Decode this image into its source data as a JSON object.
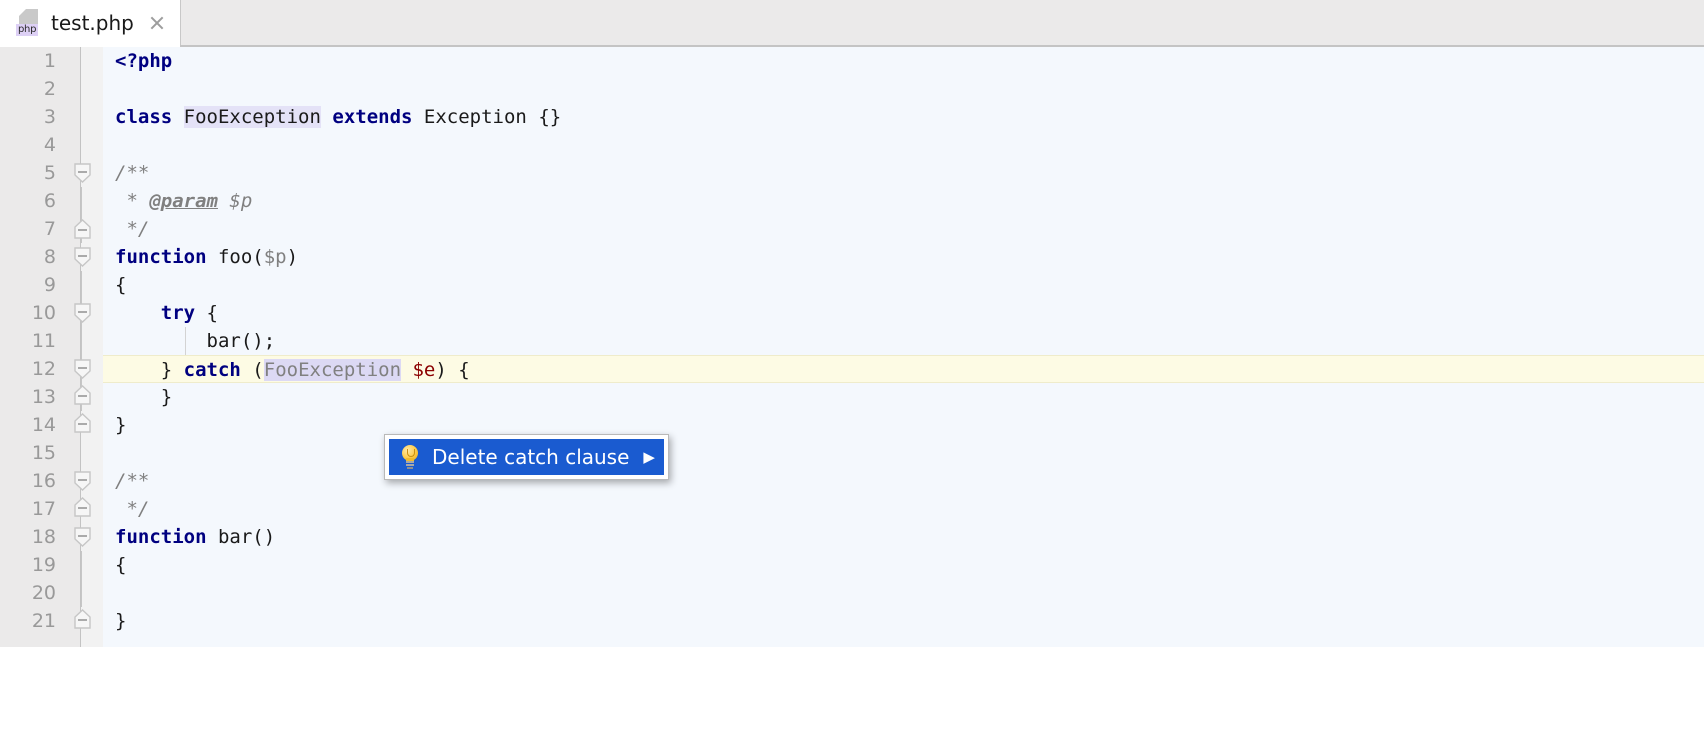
{
  "window": {
    "tabs": [
      {
        "title": "test.php",
        "icon": "php-file-icon",
        "badge": "php",
        "close_icon": "close-icon",
        "active": true
      }
    ]
  },
  "editor": {
    "language": "php",
    "current_line": 12,
    "colors": {
      "keyword": "#000080",
      "comment": "#808080",
      "variable": "#8b0000",
      "class_highlight": "#e4e2f7",
      "current_line_bg": "#fdfbe4",
      "editor_bg": "#f4f8fd",
      "gutter_bg": "#ebeaea"
    },
    "lines": [
      {
        "no": "1",
        "text": "<?php"
      },
      {
        "no": "2",
        "text": ""
      },
      {
        "no": "3",
        "text": "class FooException extends Exception {}"
      },
      {
        "no": "4",
        "text": ""
      },
      {
        "no": "5",
        "text": "/**"
      },
      {
        "no": "6",
        "text": " * @param $p"
      },
      {
        "no": "7",
        "text": " */"
      },
      {
        "no": "8",
        "text": "function foo($p)"
      },
      {
        "no": "9",
        "text": "{"
      },
      {
        "no": "10",
        "text": "    try {"
      },
      {
        "no": "11",
        "text": "        bar();"
      },
      {
        "no": "12",
        "text": "    } catch (FooException $e) {"
      },
      {
        "no": "13",
        "text": "    }"
      },
      {
        "no": "14",
        "text": "}"
      },
      {
        "no": "15",
        "text": ""
      },
      {
        "no": "16",
        "text": "/**"
      },
      {
        "no": "17",
        "text": " */"
      },
      {
        "no": "18",
        "text": "function bar()"
      },
      {
        "no": "19",
        "text": "{"
      },
      {
        "no": "20",
        "text": ""
      },
      {
        "no": "21",
        "text": "}"
      }
    ],
    "tokens": {
      "php_open": "<?php",
      "kw_class": "class",
      "name_fooexception": "FooException",
      "kw_extends": "extends",
      "name_exception": "Exception",
      "braces_empty": "{}",
      "doc_open": "/**",
      "doc_star": " * ",
      "doc_tag_param": "@param",
      "doc_param_name": " $p",
      "doc_close": " */",
      "kw_function": "function",
      "fn_foo": " foo(",
      "param_p": "$p",
      "paren_close": ")",
      "brace_open": "{",
      "brace_close": "}",
      "kw_try": "try",
      "try_brace": " {",
      "call_bar": "bar();",
      "catch_prefix": "} ",
      "kw_catch": "catch",
      "catch_paren": " (",
      "catch_type": "FooException",
      "catch_var": " $e",
      "catch_tail": ") {",
      "fn_bar": " bar()"
    }
  },
  "popup": {
    "name": "intention-action-popup",
    "icon": "lightbulb-icon",
    "label": "Delete catch clause",
    "arrow": "▶",
    "selected": true,
    "background": "#1a5bd0"
  }
}
